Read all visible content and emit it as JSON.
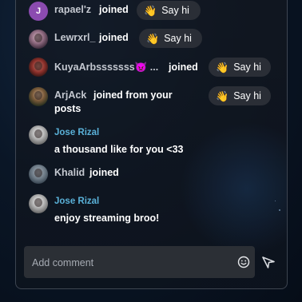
{
  "chat": {
    "joins": [
      {
        "initial": "J",
        "username": "rapael'z",
        "joined_text": "joined",
        "say_hi_label": "Say hi"
      },
      {
        "username": "Lewrxrl_",
        "joined_text": "joined",
        "say_hi_label": "Say hi"
      },
      {
        "username": "KuyaArbsssssss👿 ...",
        "joined_text": "joined",
        "say_hi_label": "Say hi"
      },
      {
        "username": "ArjAck",
        "joined_text_line1": "joined from your",
        "joined_text_line2": "posts",
        "say_hi_label": "Say hi"
      }
    ],
    "comments": [
      {
        "username": "Jose Rizal",
        "text": "a thousand like for you <33"
      },
      {
        "username": "Khalid",
        "joined_text": "joined"
      },
      {
        "username": "Jose Rizal",
        "text": "enjoy streaming broo!"
      }
    ]
  },
  "input": {
    "placeholder": "Add comment"
  },
  "icons": {
    "wave": "waving-hand-icon",
    "emoji": "smiley-face-icon",
    "send": "send-arrow-icon"
  },
  "colors": {
    "say_hi_bg": "#2a2e36",
    "comment_username": "#5ab1d8",
    "input_bg": "#2b2f35"
  }
}
